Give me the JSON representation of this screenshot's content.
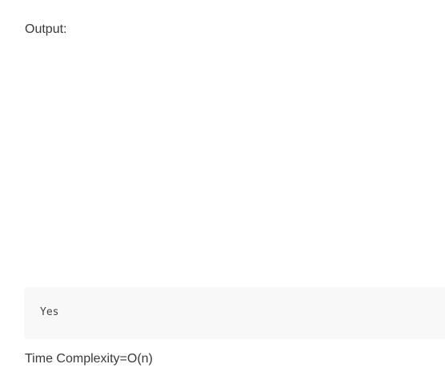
{
  "output_heading": "Output:",
  "code_block": {
    "text": "Yes"
  },
  "complexity_text": "Time Complexity=O(n)"
}
